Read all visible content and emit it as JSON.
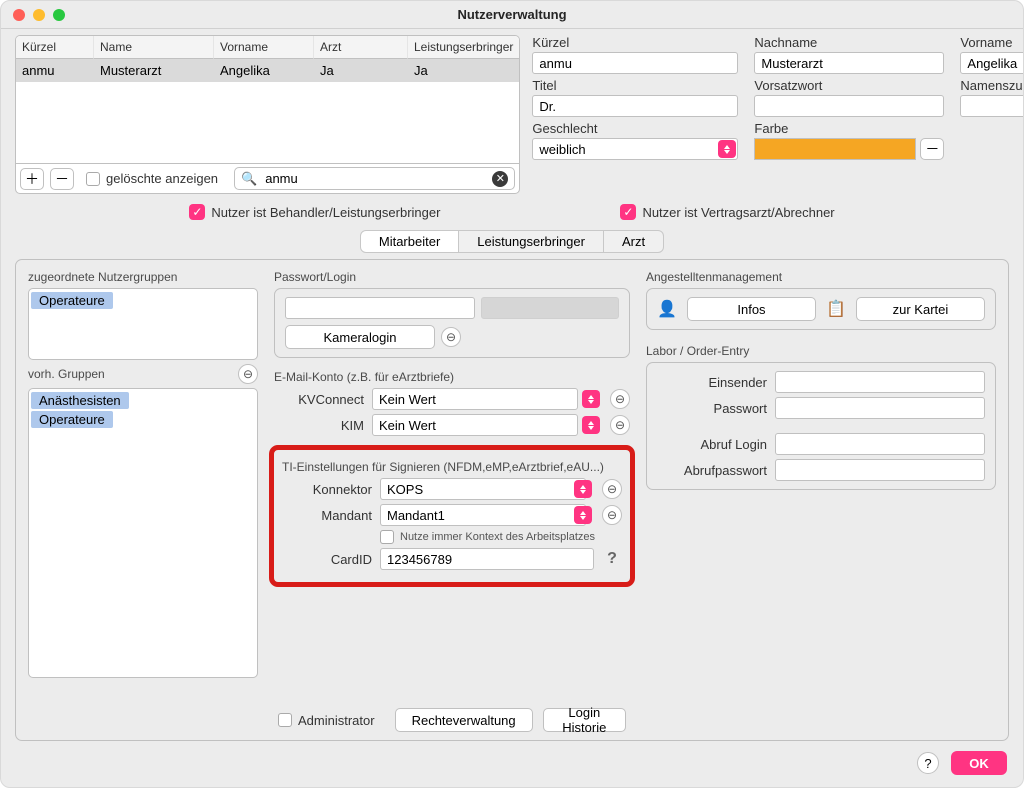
{
  "window": {
    "title": "Nutzerverwaltung"
  },
  "list": {
    "columns": [
      "Kürzel",
      "Name",
      "Vorname",
      "Arzt",
      "Leistungserbringer"
    ],
    "rows": [
      {
        "kuerzel": "anmu",
        "name": "Musterarzt",
        "vorname": "Angelika",
        "arzt": "Ja",
        "le": "Ja"
      }
    ],
    "show_deleted_label": "gelöschte anzeigen",
    "search_value": "anmu"
  },
  "identity": {
    "kuerzel_label": "Kürzel",
    "kuerzel": "anmu",
    "nachname_label": "Nachname",
    "nachname": "Musterarzt",
    "vorname_label": "Vorname",
    "vorname": "Angelika",
    "titel_label": "Titel",
    "titel": "Dr.",
    "vorsatz_label": "Vorsatzwort",
    "vorsatz": "",
    "zusatz_label": "Namenszusatz",
    "zusatz": "",
    "geschlecht_label": "Geschlecht",
    "geschlecht": "weiblich",
    "farbe_label": "Farbe",
    "farbe": "#f5a623"
  },
  "roles": {
    "behandler": "Nutzer ist Behandler/Leistungserbringer",
    "vertragsarzt": "Nutzer ist Vertragsarzt/Abrechner"
  },
  "tabs": {
    "t1": "Mitarbeiter",
    "t2": "Leistungserbringer",
    "t3": "Arzt"
  },
  "groups": {
    "assigned_label": "zugeordnete Nutzergruppen",
    "assigned": [
      "Operateure"
    ],
    "available_label": "vorh. Gruppen",
    "available": [
      "Anästhesisten",
      "Operateure"
    ]
  },
  "pwd": {
    "section": "Passwort/Login",
    "kameralogin": "Kameralogin"
  },
  "email": {
    "section": "E-Mail-Konto (z.B. für eArztbriefe)",
    "kvconnect_label": "KVConnect",
    "kvconnect": "Kein Wert",
    "kim_label": "KIM",
    "kim": "Kein Wert"
  },
  "ti": {
    "section": "TI-Einstellungen für Signieren (NFDM,eMP,eArztbrief,eAU...)",
    "konnektor_label": "Konnektor",
    "konnektor": "KOPS",
    "mandant_label": "Mandant",
    "mandant": "Mandant1",
    "context_label": "Nutze immer Kontext des Arbeitsplatzes",
    "cardid_label": "CardID",
    "cardid": "123456789"
  },
  "angestellte": {
    "section": "Angestelltenmanagement",
    "infos": "Infos",
    "zurkartei": "zur Kartei"
  },
  "labor": {
    "section": "Labor / Order-Entry",
    "einsender_label": "Einsender",
    "passwort_label": "Passwort",
    "abruflogin_label": "Abruf Login",
    "abrufpass_label": "Abrufpasswort"
  },
  "bottom": {
    "admin": "Administrator",
    "rechte": "Rechteverwaltung",
    "historie": "Login Historie"
  },
  "footer": {
    "ok": "OK"
  }
}
